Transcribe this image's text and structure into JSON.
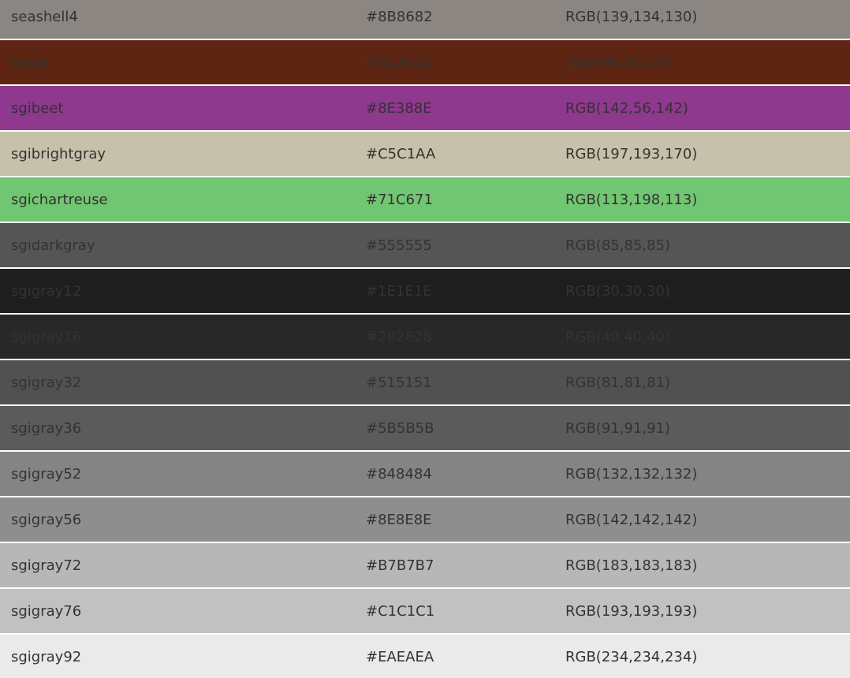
{
  "rows": [
    {
      "name": "seashell4",
      "hex": "#8B8682",
      "rgb": "RGB(139,134,130)"
    },
    {
      "name": "sepia",
      "hex": "#5E2612",
      "rgb": "RGB(94,38,18)"
    },
    {
      "name": "sgibeet",
      "hex": "#8E388E",
      "rgb": "RGB(142,56,142)"
    },
    {
      "name": "sgibrightgray",
      "hex": "#C5C1AA",
      "rgb": "RGB(197,193,170)"
    },
    {
      "name": "sgichartreuse",
      "hex": "#71C671",
      "rgb": "RGB(113,198,113)"
    },
    {
      "name": "sgidarkgray",
      "hex": "#555555",
      "rgb": "RGB(85,85,85)"
    },
    {
      "name": "sgigray12",
      "hex": "#1E1E1E",
      "rgb": "RGB(30,30,30)"
    },
    {
      "name": "sgigray16",
      "hex": "#282828",
      "rgb": "RGB(40,40,40)"
    },
    {
      "name": "sgigray32",
      "hex": "#515151",
      "rgb": "RGB(81,81,81)"
    },
    {
      "name": "sgigray36",
      "hex": "#5B5B5B",
      "rgb": "RGB(91,91,91)"
    },
    {
      "name": "sgigray52",
      "hex": "#848484",
      "rgb": "RGB(132,132,132)"
    },
    {
      "name": "sgigray56",
      "hex": "#8E8E8E",
      "rgb": "RGB(142,142,142)"
    },
    {
      "name": "sgigray72",
      "hex": "#B7B7B7",
      "rgb": "RGB(183,183,183)"
    },
    {
      "name": "sgigray76",
      "hex": "#C1C1C1",
      "rgb": "RGB(193,193,193)"
    },
    {
      "name": "sgigray92",
      "hex": "#EAEAEA",
      "rgb": "RGB(234,234,234)"
    }
  ]
}
